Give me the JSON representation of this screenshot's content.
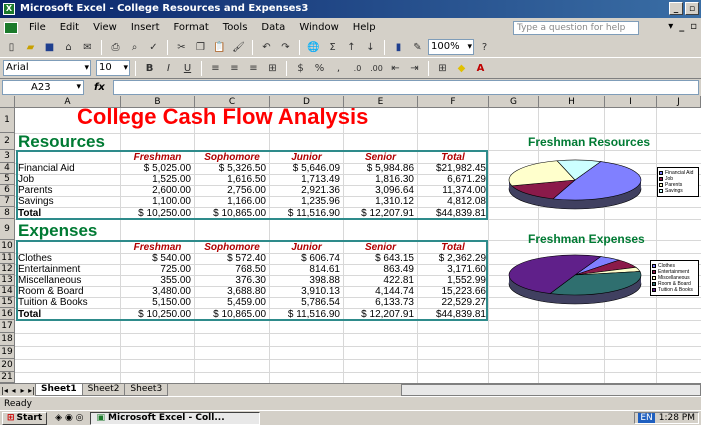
{
  "window": {
    "title": "Microsoft Excel - College Resources and Expenses3"
  },
  "menu": [
    "File",
    "Edit",
    "View",
    "Insert",
    "Format",
    "Tools",
    "Data",
    "Window",
    "Help"
  ],
  "help_box": {
    "placeholder": "Type a question for help"
  },
  "toolbar": {
    "zoom": "100%",
    "font": "Arial",
    "font_size": "10"
  },
  "formula_bar": {
    "name_box": "A23",
    "fx": "fx",
    "content": ""
  },
  "columns": [
    "A",
    "B",
    "C",
    "D",
    "E",
    "F",
    "G",
    "H",
    "I",
    "J"
  ],
  "rows": [
    "1",
    "2",
    "3",
    "4",
    "5",
    "6",
    "7",
    "8",
    "9",
    "10",
    "11",
    "12",
    "13",
    "14",
    "15",
    "16",
    "17",
    "18",
    "19",
    "20",
    "21"
  ],
  "sheet": {
    "title": "College Cash Flow Analysis",
    "resources_label": "Resources",
    "expenses_label": "Expenses",
    "year_headers": [
      "Freshman",
      "Sophomore",
      "Junior",
      "Senior",
      "Total"
    ],
    "resources": [
      {
        "label": "Financial Aid",
        "values": [
          "$    5,025.00",
          "$    5,326.50",
          "$    5,646.09",
          "$    5,984.86",
          "$21,982.45"
        ]
      },
      {
        "label": "Job",
        "values": [
          "1,525.00",
          "1,616.50",
          "1,713.49",
          "1,816.30",
          "6,671.29"
        ]
      },
      {
        "label": "Parents",
        "values": [
          "2,600.00",
          "2,756.00",
          "2,921.36",
          "3,096.64",
          "11,374.00"
        ]
      },
      {
        "label": "Savings",
        "values": [
          "1,100.00",
          "1,166.00",
          "1,235.96",
          "1,310.12",
          "4,812.08"
        ]
      },
      {
        "label": "Total",
        "values": [
          "$ 10,250.00",
          "$ 10,865.00",
          "$ 11,516.90",
          "$ 12,207.91",
          "$44,839.81"
        ]
      }
    ],
    "expenses": [
      {
        "label": "Clothes",
        "values": [
          "$       540.00",
          "$       572.40",
          "$       606.74",
          "$       643.15",
          "$  2,362.29"
        ]
      },
      {
        "label": "Entertainment",
        "values": [
          "725.00",
          "768.50",
          "814.61",
          "863.49",
          "3,171.60"
        ]
      },
      {
        "label": "Miscellaneous",
        "values": [
          "355.00",
          "376.30",
          "398.88",
          "422.81",
          "1,552.99"
        ]
      },
      {
        "label": "Room & Board",
        "values": [
          "3,480.00",
          "3,688.80",
          "3,910.13",
          "4,144.74",
          "15,223.66"
        ]
      },
      {
        "label": "Tuition & Books",
        "values": [
          "5,150.00",
          "5,459.00",
          "5,786.54",
          "6,133.73",
          "22,529.27"
        ]
      },
      {
        "label": "Total",
        "values": [
          "$ 10,250.00",
          "$ 10,865.00",
          "$ 11,516.90",
          "$ 12,207.91",
          "$44,839.81"
        ]
      }
    ]
  },
  "charts": {
    "resources_title": "Freshman Resources",
    "expenses_title": "Freshman Expenses",
    "resources_legend": [
      "Financial Aid",
      "Job",
      "Parents",
      "Savings"
    ],
    "expenses_legend": [
      "Clothes",
      "Entertainment",
      "Miscellaneous",
      "Room & Board",
      "Tuition & Books"
    ],
    "colors": {
      "blue": "#8080ff",
      "maroon": "#8b1a4a",
      "cream": "#ffffcc",
      "cyan": "#ccffff",
      "teal": "#2f6f6f",
      "purple": "#60208a"
    }
  },
  "chart_data": [
    {
      "type": "pie",
      "title": "Freshman Resources",
      "categories": [
        "Financial Aid",
        "Job",
        "Parents",
        "Savings"
      ],
      "values": [
        5025,
        1525,
        2600,
        1100
      ]
    },
    {
      "type": "pie",
      "title": "Freshman Expenses",
      "categories": [
        "Clothes",
        "Entertainment",
        "Miscellaneous",
        "Room & Board",
        "Tuition & Books"
      ],
      "values": [
        540,
        725,
        355,
        3480,
        5150
      ]
    }
  ],
  "sheet_tabs": [
    "Sheet1",
    "Sheet2",
    "Sheet3"
  ],
  "status": "Ready",
  "taskbar": {
    "start": "Start",
    "task": "Microsoft Excel - Coll...",
    "lang": "EN",
    "time": "1:28 PM"
  }
}
